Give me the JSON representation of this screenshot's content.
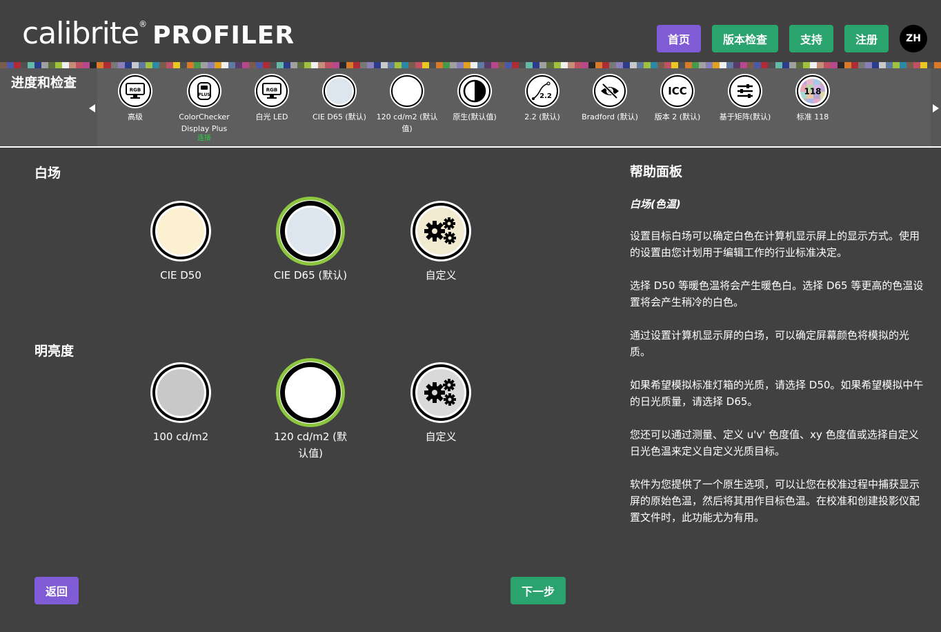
{
  "header": {
    "logo_main": "calibrite",
    "logo_reg": "®",
    "logo_product": "PROFILER",
    "nav": [
      {
        "label": "首页",
        "color": "#7f5bd5"
      },
      {
        "label": "版本检查",
        "color": "#2ba36e"
      },
      {
        "label": "支持",
        "color": "#2ba36e"
      },
      {
        "label": "注册",
        "color": "#2ba36e"
      }
    ],
    "language": "ZH"
  },
  "progress": {
    "title": "进度和检查",
    "steps": [
      {
        "label": "高级",
        "icon": "rgb-monitor-icon"
      },
      {
        "label": "ColorChecker Display Plus",
        "sub": "连接",
        "icon": "plus-device-icon"
      },
      {
        "label": "白光 LED",
        "icon": "rgb-monitor-icon"
      },
      {
        "label": "CIE D65 (默认)",
        "icon": "d65-swatch-icon"
      },
      {
        "label": "120 cd/m2 (默认值)",
        "icon": "white-swatch-icon"
      },
      {
        "label": "原生(默认值)",
        "icon": "half-contrast-icon"
      },
      {
        "label": "2.2 (默认)",
        "icon": "gamma-curve-icon"
      },
      {
        "label": "Bradford (默认)",
        "icon": "eye-hidden-icon"
      },
      {
        "label": "版本 2 (默认)",
        "icon": "icc-icon"
      },
      {
        "label": "基于矩阵(默认)",
        "icon": "sliders-icon"
      },
      {
        "label": "标准 118",
        "icon": "patch-118-icon"
      }
    ]
  },
  "whitepoint": {
    "title": "白场",
    "options": [
      {
        "label": "CIE D50",
        "swatch": "#fbf0d0",
        "selected": false
      },
      {
        "label": "CIE D65 (默认)",
        "swatch": "#dde6ee",
        "selected": true
      },
      {
        "label": "自定义",
        "swatch": "#f2ead0",
        "selected": false,
        "icon": "gears-icon"
      }
    ]
  },
  "luminance": {
    "title": "明亮度",
    "options": [
      {
        "label": "100 cd/m2",
        "swatch": "#c8c8c8",
        "selected": false
      },
      {
        "label": "120 cd/m2 (默认值)",
        "swatch": "#ffffff",
        "selected": true
      },
      {
        "label": "自定义",
        "swatch": "#d9d9d9",
        "selected": false,
        "icon": "gears-icon"
      }
    ]
  },
  "help": {
    "title": "帮助面板",
    "subtitle": "白场(色温)",
    "paragraphs": [
      "设置目标白场可以确定白色在计算机显示屏上的显示方式。使用的设置由您计划用于编辑工作的行业标准决定。",
      "选择 D50 等暖色温将会产生暖色白。选择 D65 等更高的色温设置将会产生稍冷的白色。",
      "通过设置计算机显示屏的白场，可以确定屏幕颜色将模拟的光质。",
      "如果希望模拟标准灯箱的光质，请选择 D50。如果希望模拟中午的日光质量，请选择 D65。",
      "您还可以通过测量、定义 u'v' 色度值、xy 色度值或选择自定义日光色温来定义自定义光质目标。",
      "软件为您提供了一个原生选项，可以让您在校准过程中捕获显示屏的原始色温，然后将其用作目标色温。在校准和创建投影仪配置文件时，此功能尤为有用。"
    ]
  },
  "footer": {
    "back_label": "返回",
    "next_label": "下一步"
  },
  "colors": {
    "background": "#414141",
    "accent_purple": "#7f5bd5",
    "accent_green": "#2ba36e",
    "selected_ring": "#8dc63f"
  }
}
